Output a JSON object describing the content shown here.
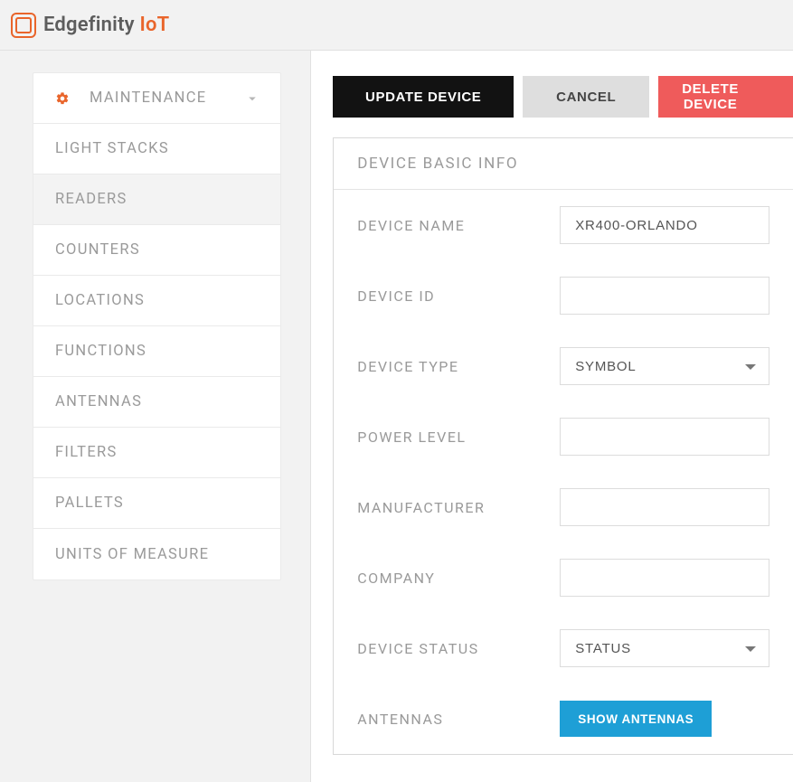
{
  "brand": {
    "name_prefix": "Edgefinity ",
    "name_accent": "IoT"
  },
  "sidebar": {
    "header": "MAINTENANCE",
    "active_index": 1,
    "items": [
      "LIGHT STACKS",
      "READERS",
      "COUNTERS",
      "LOCATIONS",
      "FUNCTIONS",
      "ANTENNAS",
      "FILTERS",
      "PALLETS",
      "UNITS OF MEASURE"
    ]
  },
  "actions": {
    "update": "UPDATE DEVICE",
    "cancel": "CANCEL",
    "delete": "DELETE DEVICE"
  },
  "panel": {
    "title": "DEVICE BASIC INFO",
    "labels": {
      "device_name": "DEVICE NAME",
      "device_id": "DEVICE ID",
      "device_type": "DEVICE TYPE",
      "power_level": "POWER LEVEL",
      "manufacturer": "MANUFACTURER",
      "company": "COMPANY",
      "device_status": "DEVICE STATUS",
      "antennas": "ANTENNAS"
    },
    "values": {
      "device_name": "XR400-ORLANDO",
      "device_id": "",
      "device_type": "SYMBOL",
      "power_level": "",
      "manufacturer": "",
      "company": "",
      "device_status": "STATUS"
    },
    "buttons": {
      "show_antennas": "SHOW ANTENNAS"
    }
  }
}
